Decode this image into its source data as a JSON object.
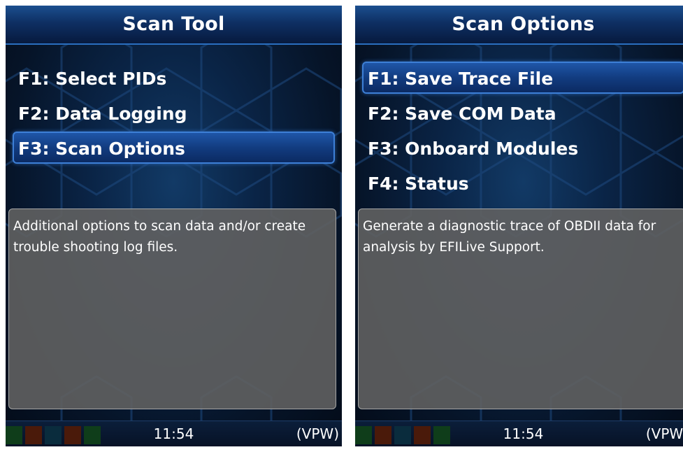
{
  "screens": [
    {
      "title": "Scan Tool",
      "menu": [
        {
          "label": "F1: Select PIDs",
          "selected": false
        },
        {
          "label": "F2: Data Logging",
          "selected": false
        },
        {
          "label": "F3: Scan Options",
          "selected": true
        }
      ],
      "description": "Additional options to scan data and/or create trouble shooting log files.",
      "status": {
        "time": "11:54",
        "protocol": "(VPW)"
      }
    },
    {
      "title": "Scan Options",
      "menu": [
        {
          "label": "F1: Save Trace File",
          "selected": true
        },
        {
          "label": "F2: Save COM Data",
          "selected": false
        },
        {
          "label": "F3: Onboard Modules",
          "selected": false
        },
        {
          "label": "F4: Status",
          "selected": false
        }
      ],
      "description": "Generate a diagnostic trace of OBDII data for analysis by EFILive Support.",
      "status": {
        "time": "11:54",
        "protocol": "(VPW)"
      }
    }
  ],
  "colors": {
    "title_bar": "#0e2f63",
    "selection": "#1f56a8",
    "description_panel": "#606060",
    "led_colors": [
      "#0f3d1a",
      "#4a1a0a",
      "#0a2c3d",
      "#4a1a0a",
      "#0f3d1a"
    ]
  },
  "icons": [
    "status-led-icon"
  ]
}
